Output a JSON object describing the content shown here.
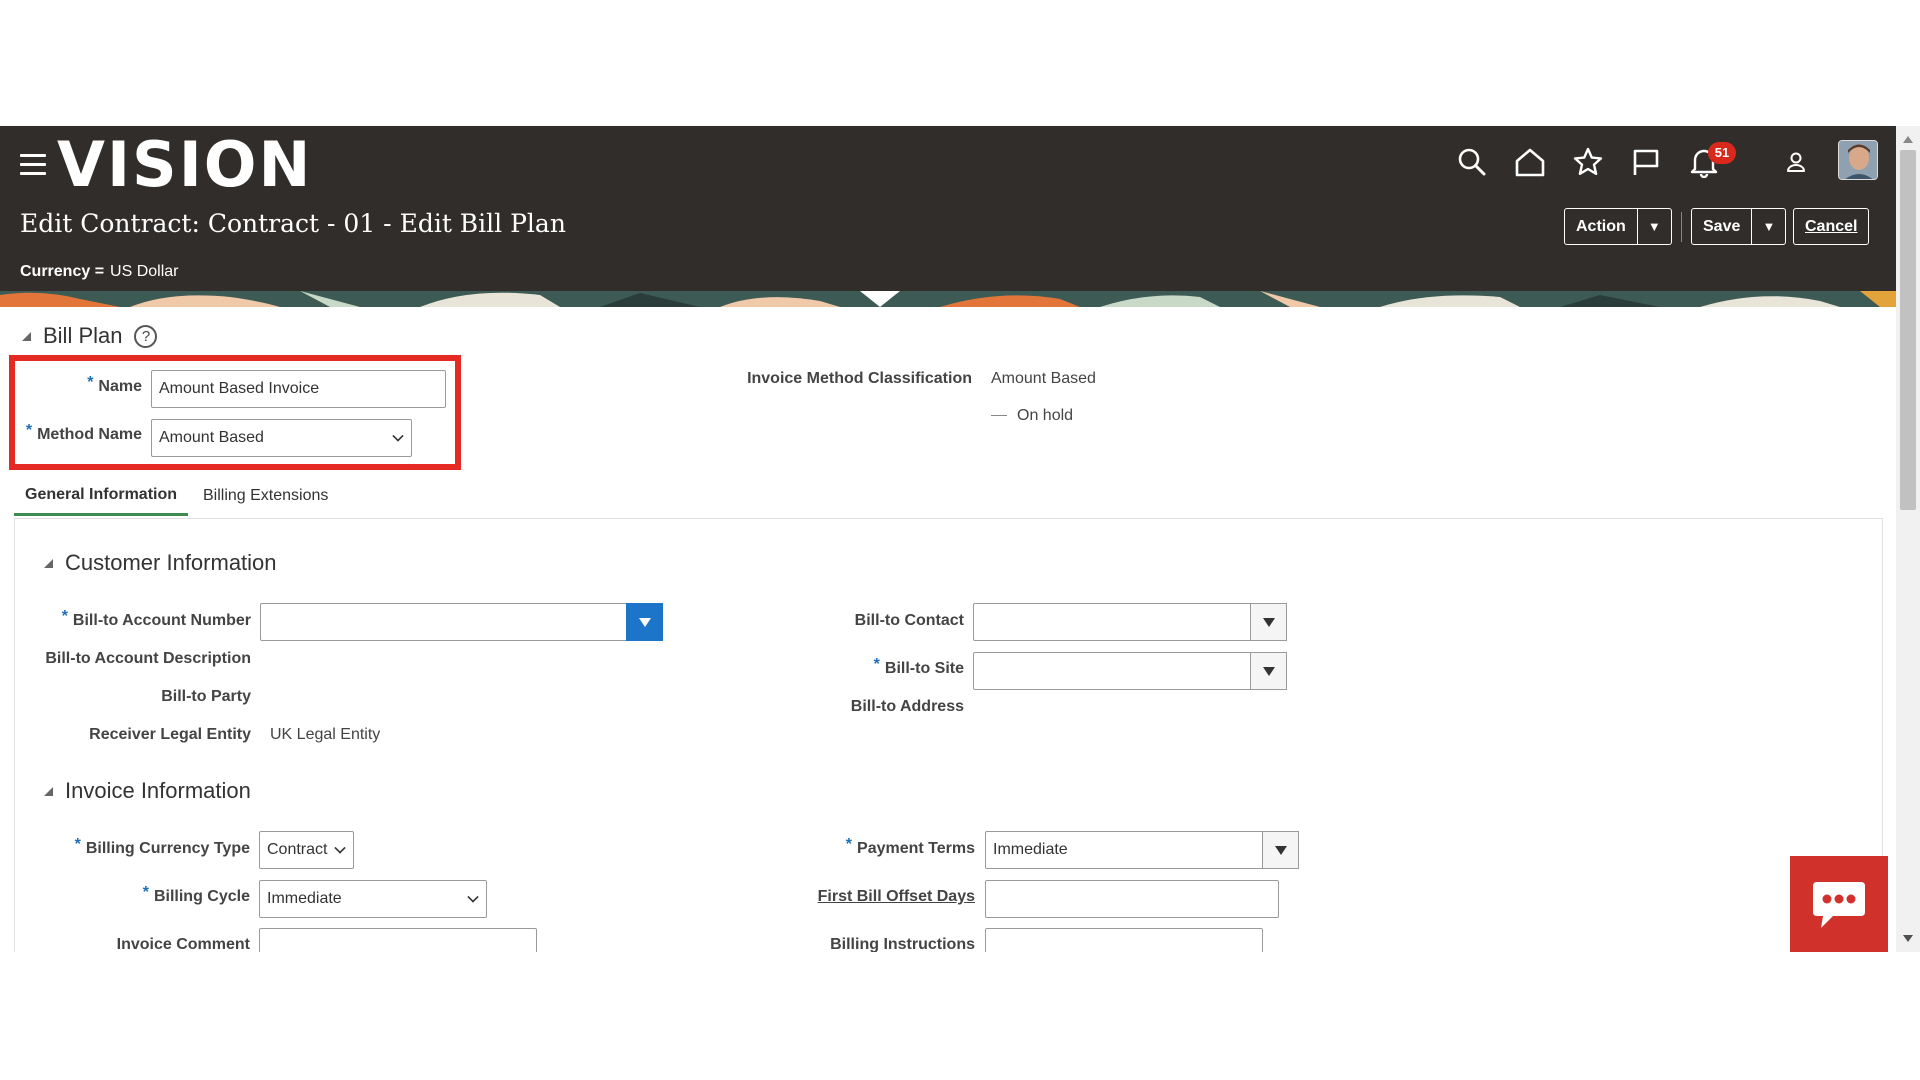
{
  "header": {
    "logo": "VISION",
    "notification_count": "51",
    "page_title": "Edit Contract: Contract - 01 - Edit Bill Plan",
    "currency_label": "Currency =",
    "currency_value": "US Dollar",
    "action_label": "Action",
    "save_label": "Save",
    "cancel_label": "Cancel",
    "icons": [
      "hamburger-icon",
      "search-icon",
      "home-icon",
      "star-icon",
      "flag-icon",
      "bell-icon",
      "user-icon"
    ]
  },
  "bill_plan": {
    "title": "Bill Plan",
    "name_label": "Name",
    "name_value": "Amount Based Invoice",
    "method_label": "Method Name",
    "method_value": "Amount Based",
    "classification_label": "Invoice Method Classification",
    "classification_value": "Amount Based",
    "on_hold_label": "On hold"
  },
  "tabs": [
    {
      "label": "General Information",
      "active": true
    },
    {
      "label": "Billing Extensions",
      "active": false
    }
  ],
  "customer_info": {
    "title": "Customer Information",
    "bill_to_account_number_label": "Bill-to Account Number",
    "bill_to_account_number_value": "",
    "bill_to_account_description_label": "Bill-to Account Description",
    "bill_to_party_label": "Bill-to Party",
    "receiver_legal_entity_label": "Receiver Legal Entity",
    "receiver_legal_entity_value": "UK Legal Entity",
    "bill_to_contact_label": "Bill-to Contact",
    "bill_to_site_label": "Bill-to Site",
    "bill_to_address_label": "Bill-to Address"
  },
  "invoice_info": {
    "title": "Invoice Information",
    "billing_currency_type_label": "Billing Currency Type",
    "billing_currency_type_value": "Contract",
    "billing_cycle_label": "Billing Cycle",
    "billing_cycle_value": "Immediate",
    "invoice_comment_label": "Invoice Comment",
    "payment_terms_label": "Payment Terms",
    "payment_terms_value": "Immediate",
    "first_bill_offset_days_label": "First Bill Offset Days",
    "billing_instructions_label": "Billing Instructions"
  },
  "colors": {
    "header_bg": "#312d2a",
    "required_marker": "#1d6fb8",
    "highlight_box": "#e52a24",
    "active_tab_underline": "#3e8b4f",
    "chat_button": "#d0322b"
  }
}
